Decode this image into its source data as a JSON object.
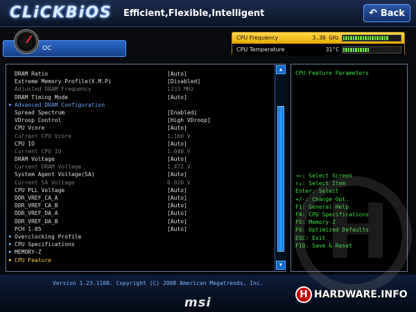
{
  "header": {
    "brand": "CLiCKBiOS",
    "tagline": "Efficient,Flexible,Intelligent",
    "back_label": "Back"
  },
  "oc_tab": {
    "label": "OC"
  },
  "status": {
    "cpu_frequency": {
      "label": "CPU Frequency",
      "value": "3.30 GHz",
      "meter_fraction": 0.8
    },
    "cpu_temperature": {
      "label": "CPU Temperature",
      "value": "31°C",
      "meter_fraction": 0.45
    }
  },
  "settings": [
    {
      "label": "DRAM Ratio",
      "value": "[Auto]",
      "kind": "option"
    },
    {
      "label": "Extreme Memory Profile(X.M.P)",
      "value": "[Disabled]",
      "kind": "option"
    },
    {
      "label": "Adjusted DRAM Frequency",
      "value": "1333 MHz",
      "kind": "readonly"
    },
    {
      "label": "DRAM Timing Mode",
      "value": "[Auto]",
      "kind": "option"
    },
    {
      "label": "Advanced DRAM Configuration",
      "value": "",
      "kind": "submenu"
    },
    {
      "label": "Spread Spectrum",
      "value": "[Enabled]",
      "kind": "option"
    },
    {
      "label": "VDroop Control",
      "value": "[High VDroop]",
      "kind": "option"
    },
    {
      "label": "CPU Vcore",
      "value": "[Auto]",
      "kind": "option"
    },
    {
      "label": "Current CPU Vcore",
      "value": "1.160 V",
      "kind": "readonly"
    },
    {
      "label": "CPU IO",
      "value": "[Auto]",
      "kind": "option"
    },
    {
      "label": "Current CPU IO",
      "value": "1.040 V",
      "kind": "readonly"
    },
    {
      "label": "DRAM Voltage",
      "value": "[Auto]",
      "kind": "option"
    },
    {
      "label": "Current DRAM Voltage",
      "value": "1.472 V",
      "kind": "readonly"
    },
    {
      "label": "System Agent Voltage(SA)",
      "value": "[Auto]",
      "kind": "option"
    },
    {
      "label": "Current SA Voltage",
      "value": "0.920 V",
      "kind": "readonly"
    },
    {
      "label": "CPU PLL Voltage",
      "value": "[Auto]",
      "kind": "option"
    },
    {
      "label": "DDR_VREF_CA_A",
      "value": "[Auto]",
      "kind": "option"
    },
    {
      "label": "DDR_VREF_CA_B",
      "value": "[Auto]",
      "kind": "option"
    },
    {
      "label": "DDR_VREF_DA_A",
      "value": "[Auto]",
      "kind": "option"
    },
    {
      "label": "DDR_VREF_DA_B",
      "value": "[Auto]",
      "kind": "option"
    },
    {
      "label": "PCH 1.05",
      "value": "[Auto]",
      "kind": "option"
    },
    {
      "label": "Overclocking Profile",
      "value": "",
      "kind": "menu"
    },
    {
      "label": "CPU Specifications",
      "value": "",
      "kind": "menu"
    },
    {
      "label": "MEMORY-Z",
      "value": "",
      "kind": "menu"
    },
    {
      "label": "CPU Feature",
      "value": "",
      "kind": "selected"
    }
  ],
  "help": {
    "title": "CPU Feature Parameters",
    "hotkeys": [
      "→←: Select Screen",
      "↑↓: Select Item",
      "Enter: Select",
      "+/-: Change Opt.",
      "F1: General Help",
      "F4: CPU Specifications",
      "F5: Memory-Z",
      "F6: Optimized Defaults",
      "ESC: Exit",
      "F10: Save & Reset"
    ]
  },
  "footer": {
    "version": "Version 1.23.1108. Copyright (C) 2008 American Megatrends, Inc.",
    "vendor_logo": "msi",
    "watermark": "HARDWARE.INFO"
  },
  "icons": {
    "back": "back-arrow-icon",
    "gauge": "speedometer-icon",
    "submenu": "triangle-right-icon",
    "scroll_up": "triangle-up-icon",
    "scroll_down": "triangle-down-icon"
  },
  "colors": {
    "accent_blue": "#2c68c8",
    "help_text": "#3ee03e",
    "selected_item": "#ffd24a",
    "readonly_text": "#7d7d7d",
    "submenu_text": "#6ea6ff",
    "freq_bar": "#e6a700",
    "meter_on": "#6fe042"
  }
}
